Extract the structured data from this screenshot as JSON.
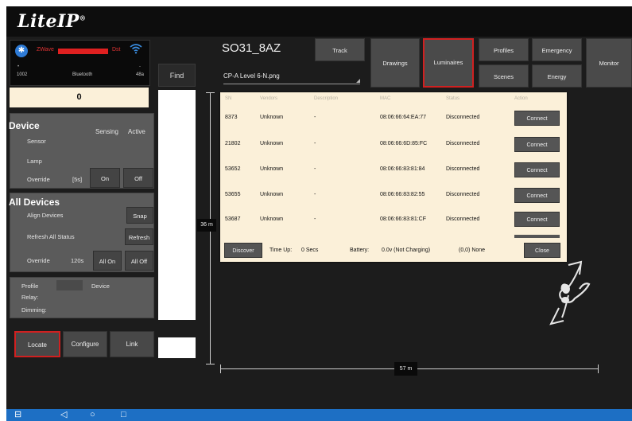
{
  "app": {
    "logo": "LiteIP",
    "logo_mark": "®"
  },
  "status": {
    "zwave_label": "ZWave",
    "dst_label": "Dst",
    "bluetooth_caption": "Bluetooth",
    "left_small": "1002",
    "right_small": "48a",
    "dash_left": "•",
    "dash_right": "-"
  },
  "find_label": "Find",
  "counter_value": "0",
  "device_panel": {
    "title": "Device",
    "col_sensing": "Sensing",
    "col_active": "Active",
    "sensor_label": "Sensor",
    "lamp_label": "Lamp",
    "override_label": "Override",
    "override_value": "[5s]",
    "on_label": "On",
    "off_label": "Off"
  },
  "all_devices_panel": {
    "title": "All Devices",
    "align_label": "Align Devices",
    "snap_label": "Snap",
    "refresh_all_label": "Refresh All Status",
    "refresh_label": "Refresh",
    "override_label": "Override",
    "override_value": "120s",
    "all_on_label": "All On",
    "all_off_label": "All Off"
  },
  "info_panel": {
    "profile_label": "Profile",
    "device_label": "Device",
    "relay_label": "Relay:",
    "dimming_label": "Dimming:"
  },
  "bottom_buttons": {
    "locate": "Locate",
    "configure": "Configure",
    "link": "Link"
  },
  "header": {
    "site_title": "SO31_8AZ",
    "drawing": "CP-A Level 6-N.png",
    "track": "Track",
    "drawings": "Drawings",
    "luminaires": "Luminaires",
    "profiles": "Profiles",
    "scenes": "Scenes",
    "emergency": "Emergency",
    "energy": "Energy",
    "monitor": "Monitor"
  },
  "map": {
    "height_dim": "36 m",
    "width_dim": "57 m"
  },
  "dialog": {
    "headers": {
      "sn": "SN",
      "vendor": "Vendors",
      "description": "Description",
      "mac": "MAC",
      "status": "Status",
      "action": "Action"
    },
    "rows": [
      {
        "sn": "8373",
        "vendor": "Unknown",
        "description": "-",
        "mac": "08:06:66:64:EA:77",
        "status": "Disconnected",
        "action": "Connect"
      },
      {
        "sn": "21802",
        "vendor": "Unknown",
        "description": "-",
        "mac": "08:06:66:6D:85:FC",
        "status": "Disconnected",
        "action": "Connect"
      },
      {
        "sn": "53652",
        "vendor": "Unknown",
        "description": "-",
        "mac": "08:06:66:83:81:84",
        "status": "Disconnected",
        "action": "Connect"
      },
      {
        "sn": "53655",
        "vendor": "Unknown",
        "description": "-",
        "mac": "08:06:66:83:82:55",
        "status": "Disconnected",
        "action": "Connect"
      },
      {
        "sn": "53687",
        "vendor": "Unknown",
        "description": "-",
        "mac": "08:06:66:83:81:CF",
        "status": "Disconnected",
        "action": "Connect"
      }
    ],
    "footer": {
      "discover": "Discover",
      "time_up_label": "Time Up:",
      "time_up_value": "0 Secs",
      "battery_label": "Battery:",
      "battery_value": "0.0v (Not Charging)",
      "coords": "(0,0) None",
      "close": "Close"
    }
  },
  "navbar": {
    "screen_icon": "⊟",
    "back_icon": "◁",
    "home_icon": "○",
    "recents_icon": "□"
  },
  "colors": {
    "accent_red": "#d02020",
    "nav_blue": "#1d6fc4",
    "dialog_bg": "#fbf0d9",
    "panel_gray": "#5b5b5b"
  }
}
